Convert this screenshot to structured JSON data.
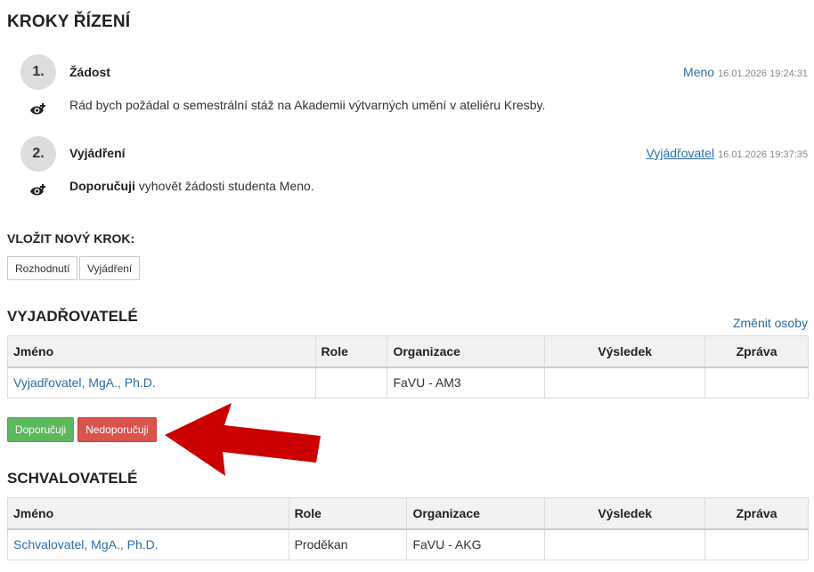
{
  "steps_section": {
    "title": "KROKY ŘÍZENÍ"
  },
  "steps": [
    {
      "number": "1.",
      "title": "Žádost",
      "author": "Meno",
      "timestamp": "16.01.2026 19:24:31",
      "text": "Rád bych požádal o semestrální stáž na Akademii výtvarných umění v ateliéru Kresby."
    },
    {
      "number": "2.",
      "title": "Vyjádření",
      "author": "Vyjádřovatel",
      "timestamp": "16.01.2026 19:37:35",
      "text_bold": "Doporučuji",
      "text": " vyhovět žádosti studenta Meno."
    }
  ],
  "new_step": {
    "title": "VLOŽIT NOVÝ KROK:",
    "buttons": [
      "Rozhodnutí",
      "Vyjádření"
    ]
  },
  "reviewers": {
    "title": "VYJADŘOVATELÉ",
    "change_link": "Změnit osoby",
    "columns": [
      "Jméno",
      "Role",
      "Organizace",
      "Výsledek",
      "Zpráva"
    ],
    "rows": [
      {
        "name": "Vyjadřovatel, MgA., Ph.D.",
        "role": "",
        "org": "FaVU - AM3",
        "result": "",
        "message": ""
      }
    ],
    "approve_label": "Doporučuji",
    "reject_label": "Nedoporučuji"
  },
  "approvers": {
    "title": "SCHVALOVATELÉ",
    "columns": [
      "Jméno",
      "Role",
      "Organizace",
      "Výsledek",
      "Zpráva"
    ],
    "rows": [
      {
        "name": "Schvalovatel, MgA., Ph.D.",
        "role": "Proděkan",
        "org": "FaVU - AKG",
        "result": "",
        "message": ""
      }
    ]
  },
  "colors": {
    "link": "#2a6ea8",
    "approve": "#5cb85c",
    "reject": "#d9534f",
    "arrow": "#cc0000"
  },
  "icons": {
    "step_visibility": "eye-plus-icon",
    "annotation": "red-arrow-annotation"
  }
}
